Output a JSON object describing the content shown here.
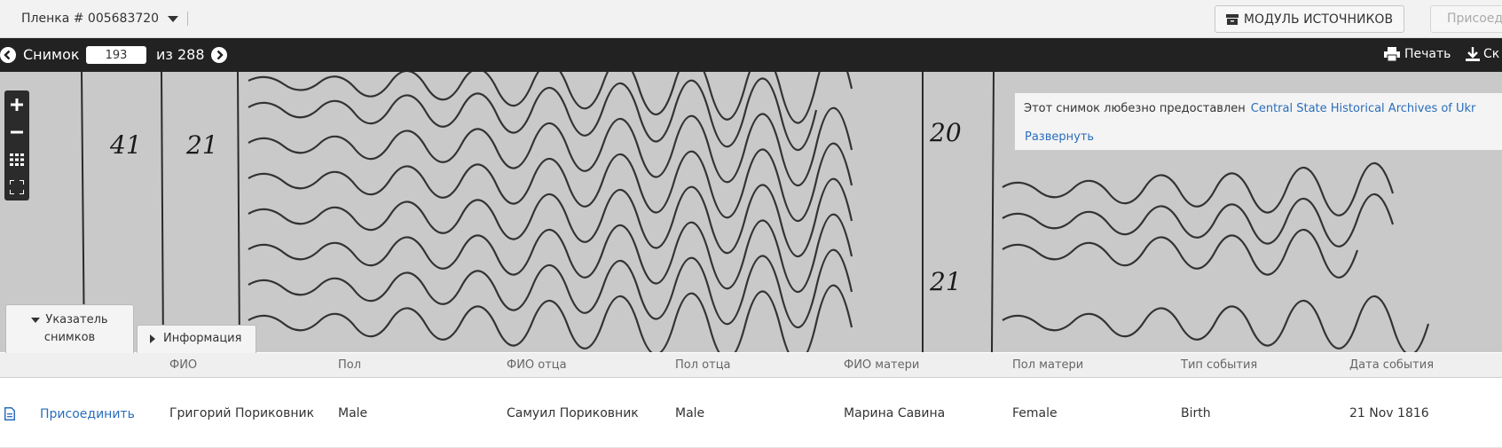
{
  "header": {
    "film_label": "Пленка # 005683720",
    "sources_button": "МОДУЛЬ ИСТОЧНИКОВ",
    "attach_button": "Присоед"
  },
  "toolbar": {
    "image_label": "Снимок",
    "image_number": "193",
    "of_label": "из 288",
    "print_label": "Печать",
    "download_label": "Ск"
  },
  "viewer": {
    "courtesy_text": "Этот снимок любезно предоставлен",
    "courtesy_source": "Central State Historical Archives of Ukr",
    "expand_link": "Развернуть",
    "tab_index_label": "Указатель снимков",
    "tab_info_label": "Информация",
    "handwriting_numbers": [
      "41",
      "21",
      "20",
      "21"
    ]
  },
  "table": {
    "columns": [
      "ФИО",
      "Пол",
      "ФИО отца",
      "Пол отца",
      "ФИО матери",
      "Пол матери",
      "Тип события",
      "Дата события"
    ],
    "rows": [
      {
        "action": "Присоединить",
        "cells": [
          "Григорий Пориковник",
          "Male",
          "Самуил Пориковник",
          "Male",
          "Марина Савина",
          "Female",
          "Birth",
          "21 Nov 1816"
        ]
      }
    ]
  },
  "colors": {
    "toolbar_bg": "#222222",
    "link": "#2a6ebb",
    "header_bg": "#f2f2f2"
  },
  "icons": [
    "chevron-down-icon",
    "archive-box-icon",
    "arrow-left-circle-icon",
    "arrow-right-circle-icon",
    "printer-icon",
    "download-icon",
    "zoom-in-icon",
    "zoom-out-icon",
    "grid-icon",
    "fullscreen-icon",
    "document-icon"
  ]
}
